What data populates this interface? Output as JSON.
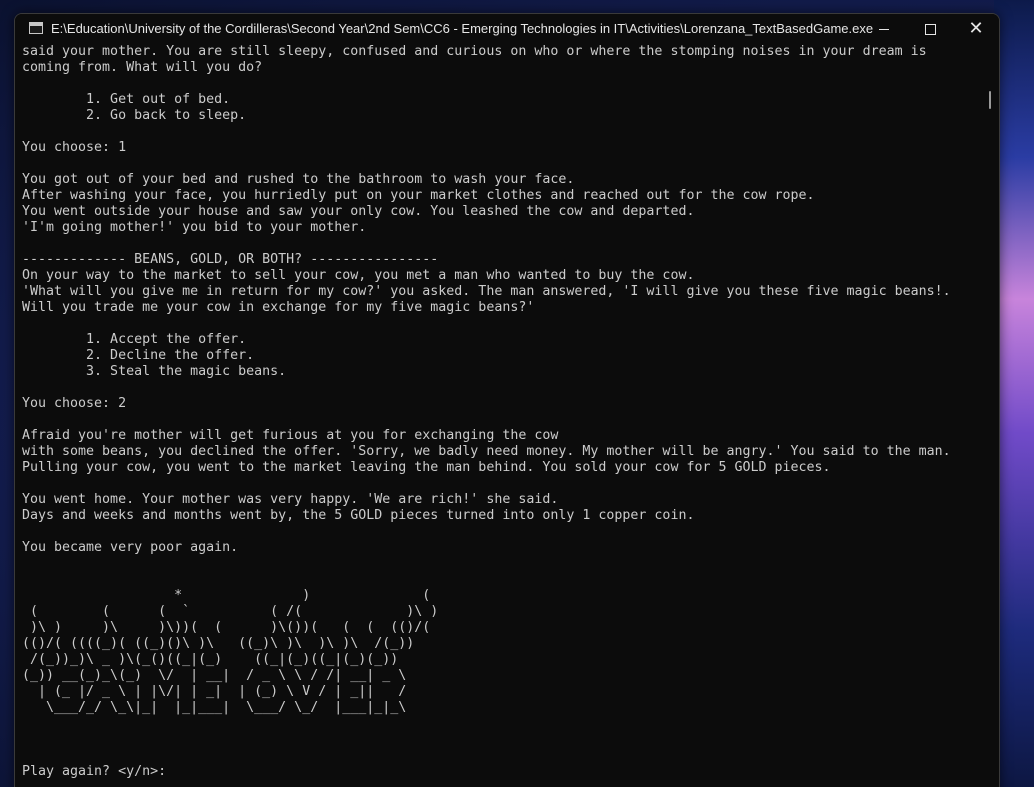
{
  "window": {
    "title": "E:\\Education\\University of the Cordilleras\\Second Year\\2nd Sem\\CC6 - Emerging Technologies in IT\\Activities\\Lorenzana_TextBasedGame.exe",
    "icon": "console-app-icon",
    "buttons": {
      "minimize": "minimize-icon",
      "maximize": "maximize-icon",
      "close": "✕"
    }
  },
  "console": {
    "lines": [
      "said your mother. You are still sleepy, confused and curious on who or where the stomping noises in your dream is",
      "coming from. What will you do?",
      "",
      "        1. Get out of bed.",
      "        2. Go back to sleep.",
      "",
      "You choose: 1",
      "",
      "You got out of your bed and rushed to the bathroom to wash your face.",
      "After washing your face, you hurriedly put on your market clothes and reached out for the cow rope.",
      "You went outside your house and saw your only cow. You leashed the cow and departed.",
      "'I'm going mother!' you bid to your mother.",
      "",
      "------------- BEANS, GOLD, OR BOTH? ----------------",
      "On your way to the market to sell your cow, you met a man who wanted to buy the cow.",
      "'What will you give me in return for my cow?' you asked. The man answered, 'I will give you these five magic beans!.",
      "Will you trade me your cow in exchange for my five magic beans?'",
      "",
      "        1. Accept the offer.",
      "        2. Decline the offer.",
      "        3. Steal the magic beans.",
      "",
      "You choose: 2",
      "",
      "Afraid you're mother will get furious at you for exchanging the cow",
      "with some beans, you declined the offer. 'Sorry, we badly need money. My mother will be angry.' You said to the man.",
      "Pulling your cow, you went to the market leaving the man behind. You sold your cow for 5 GOLD pieces.",
      "",
      "You went home. Your mother was very happy. 'We are rich!' she said.",
      "Days and weeks and months went by, the 5 GOLD pieces turned into only 1 copper coin.",
      "",
      "You became very poor again.",
      "",
      "",
      "                   *               )              (",
      " (        (      (  `          ( /(             )\\ )",
      " )\\ )     )\\     )\\))(  (      )\\())(   (  (  (()/(",
      "(()/( ((((_)( ((_)()\\ )\\   ((_)\\ )\\  )\\ )\\  /(_))",
      " /(_))_)\\ _ )\\(_()((_|(_)    ((_|(_)((_|(_)(_))",
      "(_)) __(_)_\\(_)  \\/  | __|  / _ \\ \\ / /| __| _ \\",
      "  | (_ |/ _ \\ | |\\/| | _|  | (_) \\ V / | _||   /",
      "   \\___/_/ \\_\\|_|  |_|___|  \\___/ \\_/  |___|_|_\\",
      "",
      "",
      "",
      "Play again? <y/n>:"
    ]
  }
}
